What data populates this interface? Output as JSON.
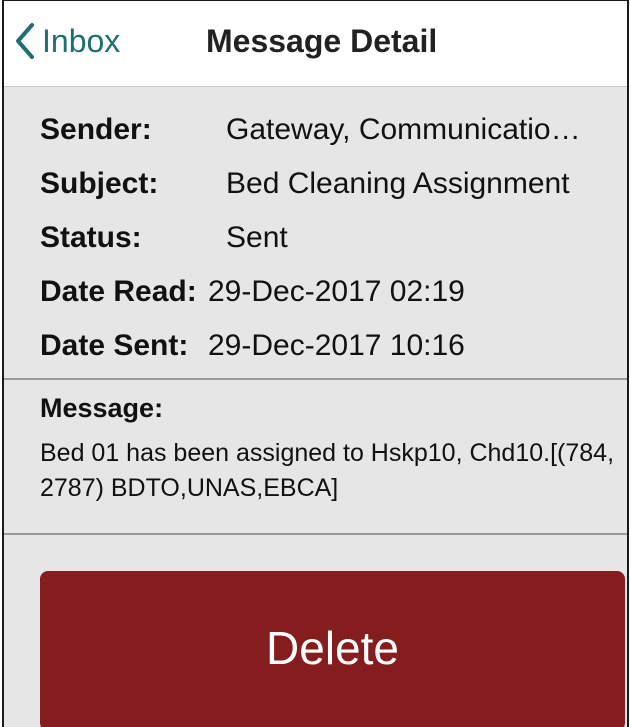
{
  "navbar": {
    "back_label": "Inbox",
    "title": "Message Detail",
    "back_icon": "chevron-left-icon"
  },
  "details": {
    "sender_label": "Sender:",
    "sender_value": "Gateway, Communicatio…",
    "subject_label": "Subject:",
    "subject_value": "Bed Cleaning Assignment",
    "status_label": "Status:",
    "status_value": "Sent",
    "date_read_label": "Date Read:",
    "date_read_value": "29-Dec-2017 02:19",
    "date_sent_label": "Date Sent:",
    "date_sent_value": "29-Dec-2017 10:16"
  },
  "message": {
    "label": "Message:",
    "body": "Bed 01 has been assigned to Hskp10, Chd10.[(784,2787) BDTO,UNAS,EBCA]"
  },
  "actions": {
    "delete_label": "Delete"
  },
  "colors": {
    "accent": "#1f6f70",
    "delete_bg": "#851d1e",
    "background": "#e6e6e6"
  }
}
